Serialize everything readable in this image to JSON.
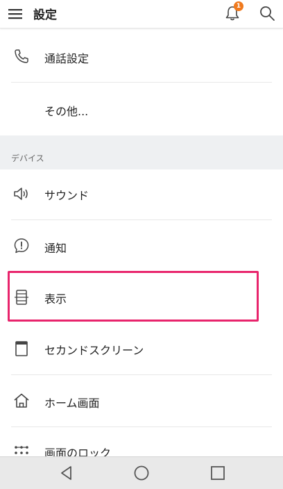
{
  "header": {
    "title": "設定",
    "notification_count": "1",
    "icons": {
      "menu": "menu-icon",
      "bell": "notification-bell-icon",
      "search": "search-icon"
    }
  },
  "list": {
    "items_top": [
      {
        "label": "通話設定",
        "icon": "phone-icon"
      },
      {
        "label": "その他..."
      }
    ],
    "section_devices": {
      "title": "デバイス",
      "items": [
        {
          "label": "サウンド",
          "icon": "speaker-icon"
        },
        {
          "label": "通知",
          "icon": "notification-alert-icon"
        },
        {
          "label": "表示",
          "icon": "display-icon"
        },
        {
          "label": "セカンドスクリーン",
          "icon": "second-screen-icon"
        },
        {
          "label": "ホーム画面",
          "icon": "home-icon"
        },
        {
          "label": "画面のロック",
          "icon": "lock-screen-grid-icon"
        }
      ]
    }
  },
  "highlight": {
    "target": "表示",
    "color": "#e8246c"
  },
  "navbar": {
    "icons": [
      "back-icon",
      "home-circle-icon",
      "recents-icon"
    ]
  },
  "colors": {
    "badge": "#f07a1e",
    "section_background": "#eef0f2",
    "navbar_background": "#e9e9e9"
  }
}
